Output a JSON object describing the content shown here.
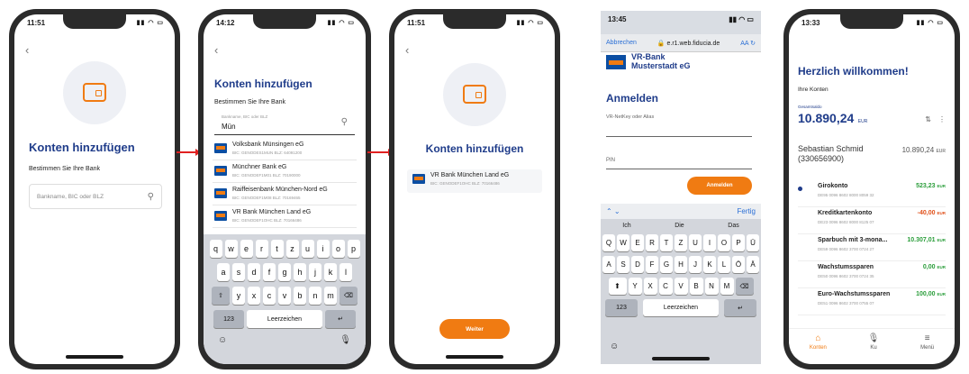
{
  "phone1": {
    "time": "11:51",
    "title": "Konten hinzufügen",
    "subtitle": "Bestimmen Sie Ihre Bank",
    "search_placeholder": "Bankname, BIC oder BLZ"
  },
  "phone2": {
    "time": "14:12",
    "title": "Konten hinzufügen",
    "subtitle": "Bestimmen Sie Ihre Bank",
    "search_label": "Bankname, BIC oder BLZ",
    "search_value": "Mün",
    "banks": [
      {
        "name": "Volksbank Münsingen eG",
        "bic": "BIC: GENODES1MUN  BLZ: 64091200"
      },
      {
        "name": "Münchner Bank eG",
        "bic": "BIC: GENODEF1M01  BLZ: 70190000"
      },
      {
        "name": "Raiffeisenbank München-Nord eG",
        "bic": "BIC: GENODEF1M08  BLZ: 70169465"
      },
      {
        "name": "VR Bank München Land eG",
        "bic": "BIC: GENODEF1OHC  BLZ: 70166486"
      }
    ],
    "keyboard_rows": [
      [
        "q",
        "w",
        "e",
        "r",
        "t",
        "z",
        "u",
        "i",
        "o",
        "p"
      ],
      [
        "a",
        "s",
        "d",
        "f",
        "g",
        "h",
        "j",
        "k",
        "l"
      ],
      [
        "y",
        "x",
        "c",
        "v",
        "b",
        "n",
        "m"
      ]
    ],
    "key_numbers": "123",
    "key_space": "Leerzeichen",
    "key_return": "↵"
  },
  "phone3": {
    "time": "11:51",
    "title": "Konten hinzufügen",
    "bank_name": "VR Bank München Land eG",
    "bank_bic": "BIC: GENODEF1OHC  BLZ: 70166486",
    "button": "Weiter"
  },
  "phone4": {
    "time": "13:45",
    "back_link": "Abbrechen",
    "url": "e.r1.web.fiducia.de",
    "aa": "AA",
    "bank_line1": "VR-Bank",
    "bank_line2": "Musterstadt eG",
    "title": "Anmelden",
    "field_user": "VR-NetKey oder Alias",
    "field_pin": "PIN",
    "button": "Anmelden",
    "done": "Fertig",
    "suggestions": [
      "Ich",
      "Die",
      "Das"
    ],
    "keyboard_rows": [
      [
        "Q",
        "W",
        "E",
        "R",
        "T",
        "Z",
        "U",
        "I",
        "O",
        "P",
        "Ü"
      ],
      [
        "A",
        "S",
        "D",
        "F",
        "G",
        "H",
        "J",
        "K",
        "L",
        "Ö",
        "Ä"
      ],
      [
        "Y",
        "X",
        "C",
        "V",
        "B",
        "N",
        "M"
      ]
    ],
    "key_numbers": "123",
    "key_space": "Leerzeichen",
    "key_return": "↵"
  },
  "phone5": {
    "time": "13:33",
    "title": "Herzlich willkommen!",
    "subtitle": "Ihre Konten",
    "balance_label": "Gesamtsaldo",
    "balance": "10.890,24",
    "currency": "EUR",
    "owner_name": "Sebastian Schmid",
    "owner_id": "(330656900)",
    "owner_balance": "10.890,24",
    "accounts": [
      {
        "name": "Girokonto",
        "iban": "DE95 0096 8602 8000 8059 32",
        "amount": "523,23",
        "color": "#2a9d3a"
      },
      {
        "name": "Kreditkartenkonto",
        "iban": "DE23 0096 8602 8000 8125 07",
        "amount": "-40,00",
        "color": "#e0501a"
      },
      {
        "name": "Sparbuch mit 3-mona...",
        "iban": "DE59 0096 8602 3700 0724 27",
        "amount": "10.307,01",
        "color": "#2a9d3a"
      },
      {
        "name": "Wachstumssparen",
        "iban": "DE50 0096 8602 3700 0724 35",
        "amount": "0,00",
        "color": "#2a9d3a"
      },
      {
        "name": "Euro-Wachstumssparen",
        "iban": "DE51 0096 8602 3700 0755 07",
        "amount": "100,00",
        "color": "#2a9d3a"
      }
    ],
    "tabs": [
      {
        "label": "Konten",
        "icon": "home-icon",
        "glyph": "⌂"
      },
      {
        "label": "Ku",
        "icon": "microphone-icon",
        "glyph": "🎙"
      },
      {
        "label": "Menü",
        "icon": "menu-icon",
        "glyph": "≡"
      }
    ]
  },
  "colors": {
    "accent": "#f07b12",
    "brand_blue": "#1f3c8a",
    "arrow": "#e02020",
    "positive": "#2a9d3a",
    "negative": "#e0501a"
  }
}
